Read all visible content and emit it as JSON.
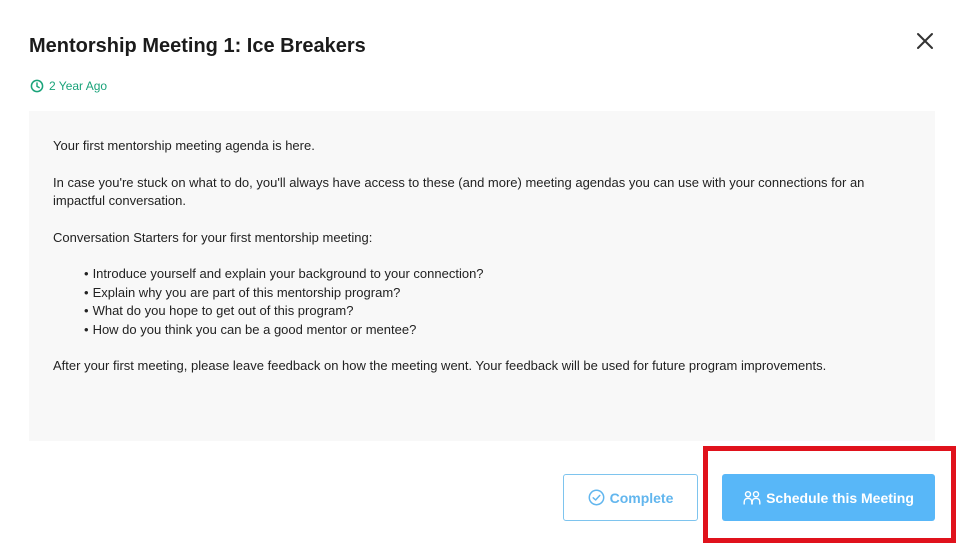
{
  "modal": {
    "title": "Mentorship Meeting 1: Ice Breakers",
    "timestamp": "2 Year Ago",
    "close_icon": "close-icon",
    "clock_icon": "clock-icon"
  },
  "content": {
    "intro": "Your first mentorship meeting agenda is here.",
    "paragraph": "In case you're stuck on what to do, you'll always have access to these (and more) meeting agendas you can use with your connections for an impactful conversation.",
    "starters_heading": "Conversation Starters for your first mentorship meeting:",
    "starters": [
      "Introduce yourself and explain your background to your connection?",
      "Explain why you are part of this mentorship program?",
      "What do you hope to get out of this program?",
      "How do you think you can be a good mentor or mentee?"
    ],
    "closing": "After your first meeting, please leave feedback on how the meeting went. Your feedback will be used for future program improvements."
  },
  "actions": {
    "complete_label": "Complete",
    "complete_icon": "check-circle-icon",
    "schedule_label": "Schedule this Meeting",
    "schedule_icon": "people-icon"
  },
  "colors": {
    "accent_green": "#1aa37a",
    "primary_blue": "#58b7f8",
    "outline_blue": "#7ec4ee",
    "highlight_red": "#e0121c",
    "panel_bg": "#f8f8f8"
  }
}
